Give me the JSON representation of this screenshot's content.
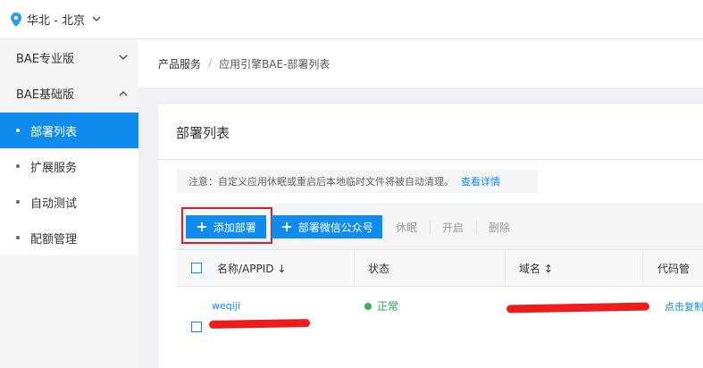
{
  "topbar": {
    "region_label": "华北 - 北京"
  },
  "sidebar": {
    "groups": [
      {
        "label": "BAE专业版",
        "expanded": false
      },
      {
        "label": "BAE基础版",
        "expanded": true
      }
    ],
    "items": [
      {
        "label": "部署列表",
        "active": true
      },
      {
        "label": "扩展服务",
        "active": false
      },
      {
        "label": "自动测试",
        "active": false
      },
      {
        "label": "配额管理",
        "active": false
      }
    ]
  },
  "breadcrumb": {
    "root": "产品服务",
    "separator": "/",
    "current": "应用引擎BAE-部署列表"
  },
  "card": {
    "title": "部署列表",
    "notice": {
      "text": "注意：自定义应用休眠或重启后本地临时文件将被自动清理。",
      "link": "查看详情"
    }
  },
  "toolbar": {
    "add_deploy": "添加部署",
    "wechat_deploy": "部署微信公众号",
    "sleep": "休眠",
    "start": "开启",
    "delete": "删除"
  },
  "table": {
    "headers": {
      "name": "名称/APPID",
      "status": "状态",
      "domain": "域名",
      "code": "代码管"
    },
    "rows": [
      {
        "name": "weqiji",
        "status": "正常",
        "code_action": "点击复制"
      }
    ]
  },
  "colors": {
    "accent": "#108cee",
    "status_ok": "#3cb34a",
    "annotation_red": "#e02020"
  },
  "icons": {
    "region": "location-pin-icon",
    "collapse": "chevron-down-icon",
    "expand": "chevron-up-icon",
    "add": "plus-icon",
    "sort_desc": "arrow-down-icon",
    "sort_both": "sort-icon"
  }
}
